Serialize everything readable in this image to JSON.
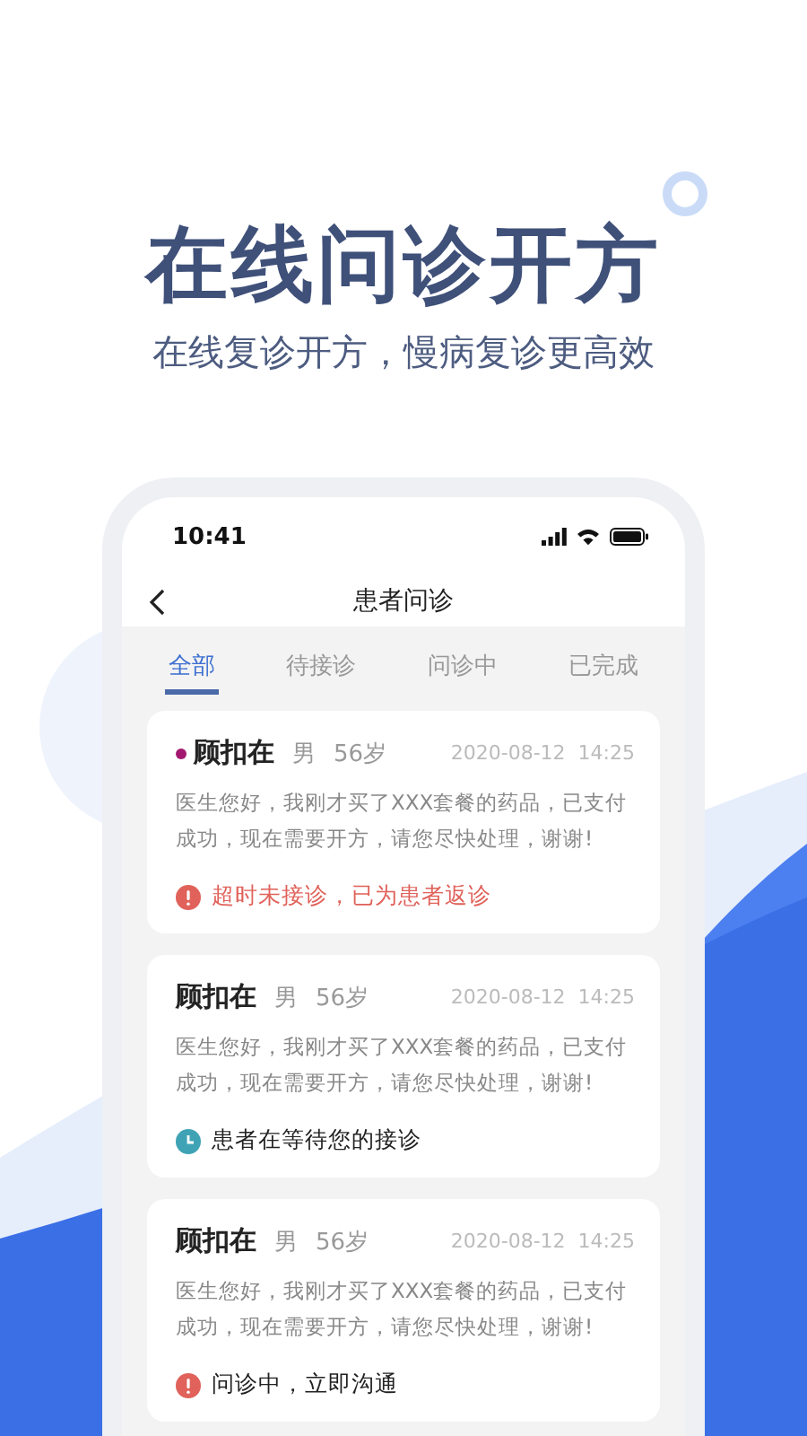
{
  "headline": "在线问诊开方",
  "subheadline": "在线复诊开方，慢病复诊更高效",
  "status_bar": {
    "time": "10:41"
  },
  "nav": {
    "title": "患者问诊"
  },
  "tabs": [
    {
      "label": "全部",
      "selected": true
    },
    {
      "label": "待接诊",
      "selected": false
    },
    {
      "label": "问诊中",
      "selected": false
    },
    {
      "label": "已完成",
      "selected": false
    }
  ],
  "consultations": [
    {
      "name": "顾扣在",
      "gender": "男",
      "age": "56岁",
      "time": "2020-08-12  14:25",
      "message": "医生您好，我刚才买了XXX套餐的药品，已支付成功，现在需要开方，请您尽快处理，谢谢!",
      "unread": true,
      "status": {
        "kind": "timeout",
        "text": "超时未接诊，已为患者返诊"
      }
    },
    {
      "name": "顾扣在",
      "gender": "男",
      "age": "56岁",
      "time": "2020-08-12  14:25",
      "message": "医生您好，我刚才买了XXX套餐的药品，已支付成功，现在需要开方，请您尽快处理，谢谢!",
      "unread": false,
      "status": {
        "kind": "waiting",
        "text": "患者在等待您的接诊"
      }
    },
    {
      "name": "顾扣在",
      "gender": "男",
      "age": "56岁",
      "time": "2020-08-12  14:25",
      "message": "医生您好，我刚才买了XXX套餐的药品，已支付成功，现在需要开方，请您尽快处理，谢谢!",
      "unread": false,
      "status": {
        "kind": "active",
        "text": "问诊中，立即沟通"
      }
    }
  ]
}
